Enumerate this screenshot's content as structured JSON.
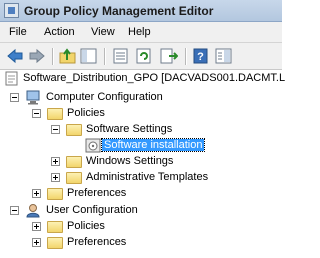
{
  "window": {
    "title": "Group Policy Management Editor"
  },
  "menu": [
    "File",
    "Action",
    "View",
    "Help"
  ],
  "tree": {
    "root": "Software_Distribution_GPO [DACVADS001.DACMT.L",
    "computer": {
      "label": "Computer Configuration",
      "policies": "Policies",
      "software_settings": "Software Settings",
      "software_installation": "Software installation",
      "windows_settings": "Windows Settings",
      "admin_templates": "Administrative Templates",
      "preferences": "Preferences"
    },
    "user": {
      "label": "User Configuration",
      "policies": "Policies",
      "preferences": "Preferences"
    }
  },
  "selected_item": "Software installation"
}
